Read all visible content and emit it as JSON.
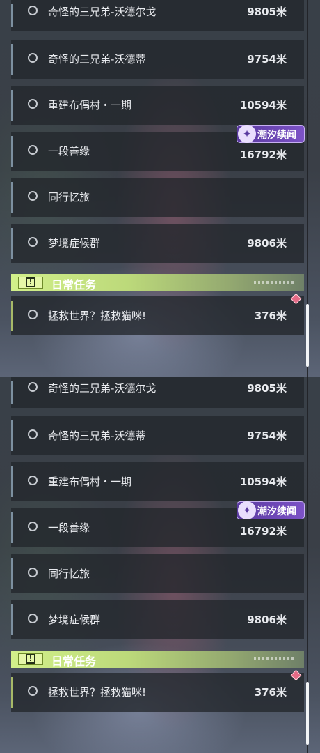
{
  "panels": [
    {
      "quests": [
        {
          "title": "奇怪的三兄弟-沃德尔戈",
          "distance": "9805米"
        },
        {
          "title": "奇怪的三兄弟-沃德蒂",
          "distance": "9754米"
        },
        {
          "title": "重建布偶村・一期",
          "distance": "10594米"
        },
        {
          "title": "一段善缘",
          "distance": "16792米"
        },
        {
          "title": "同行忆旅",
          "distance": ""
        },
        {
          "title": "梦境症候群",
          "distance": "9806米"
        }
      ],
      "event_badge": {
        "icon": "event-swirl-icon",
        "label": "潮汐续闻"
      },
      "daily_section": {
        "title": "日常任务",
        "icon": "alert-icon"
      },
      "daily_quests": [
        {
          "title": "拯救世界？拯救猫咪!",
          "distance": "376米"
        }
      ]
    },
    {
      "quests": [
        {
          "title": "奇怪的三兄弟-沃德尔戈",
          "distance": "9805米"
        },
        {
          "title": "奇怪的三兄弟-沃德蒂",
          "distance": "9754米"
        },
        {
          "title": "重建布偶村・一期",
          "distance": "10594米"
        },
        {
          "title": "一段善缘",
          "distance": "16792米"
        },
        {
          "title": "同行忆旅",
          "distance": ""
        },
        {
          "title": "梦境症候群",
          "distance": "9806米"
        }
      ],
      "event_badge": {
        "icon": "event-swirl-icon",
        "label": "潮汐续闻"
      },
      "daily_section": {
        "title": "日常任务",
        "icon": "alert-icon"
      },
      "daily_quests": [
        {
          "title": "拯救世界？拯救猫咪!",
          "distance": "376米"
        }
      ]
    }
  ],
  "colors": {
    "daily_accent": "#c8e67e",
    "event_badge": "#6b46b8",
    "tracked_marker": "#e46a86"
  }
}
